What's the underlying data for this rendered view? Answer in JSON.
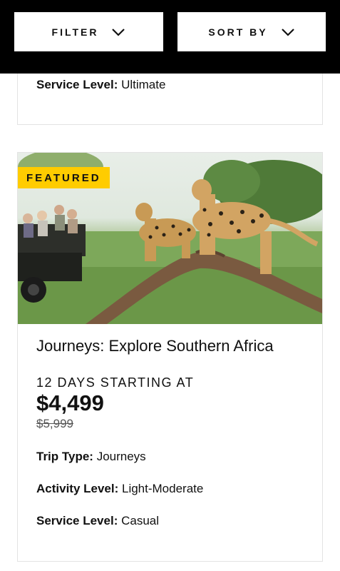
{
  "toolbar": {
    "filter_label": "FILTER",
    "sort_label": "SORT BY"
  },
  "previous_card": {
    "service_level_label": "Service Level:",
    "service_level_value": " Ultimate"
  },
  "trip": {
    "badge": "FEATURED",
    "title": "Journeys: Explore Southern Africa",
    "duration_prefix": "12 DAYS STARTING AT",
    "price": "$4,499",
    "original_price": "$5,999",
    "trip_type_label": "Trip Type:",
    "trip_type_value": " Journeys",
    "activity_level_label": "Activity Level:",
    "activity_level_value": " Light-Moderate",
    "service_level_label": "Service Level:",
    "service_level_value": " Casual"
  },
  "colors": {
    "badge": "#ffcc00",
    "topbar": "#000000"
  }
}
